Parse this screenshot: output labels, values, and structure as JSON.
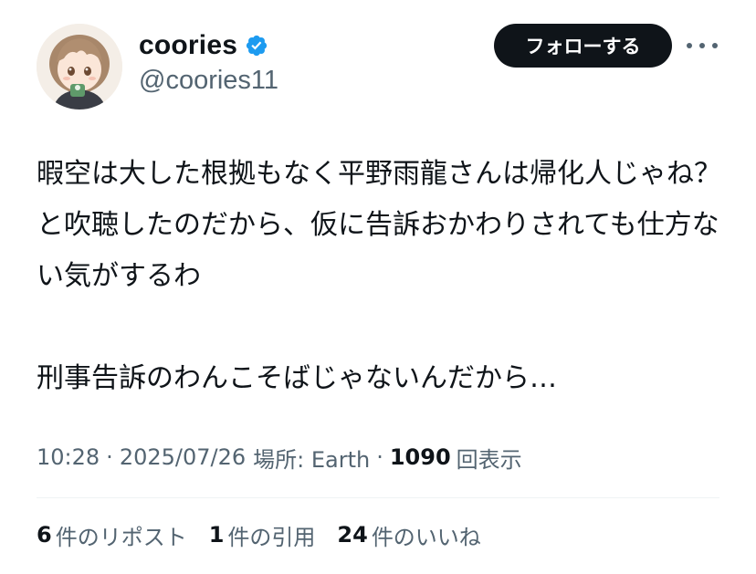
{
  "author": {
    "display_name": "coories",
    "handle": "@coories11",
    "verified": true,
    "verified_color": "#1d9bf0"
  },
  "header": {
    "follow_label": "フォローする",
    "more_icon": "more-icon"
  },
  "tweet": {
    "paragraphs": [
      "暇空は大した根拠もなく平野雨龍さんは帰化人じゃね？と吹聴したのだから、仮に告訴おかわりされても仕方ない気がするわ",
      "刑事告訴のわんこそばじゃないんだから…"
    ]
  },
  "meta": {
    "time": "10:28",
    "separator": "·",
    "date": "2025/07/26",
    "location": "場所: Earth",
    "views_count": "1090",
    "views_label": "回表示"
  },
  "stats": {
    "reposts_count": "6",
    "reposts_label": "件のリポスト",
    "quotes_count": "1",
    "quotes_label": "件の引用",
    "likes_count": "24",
    "likes_label": "件のいいね"
  },
  "colors": {
    "text_primary": "#0f1419",
    "text_secondary": "#536471",
    "follow_bg": "#0f1419",
    "divider": "#eff3f4"
  }
}
